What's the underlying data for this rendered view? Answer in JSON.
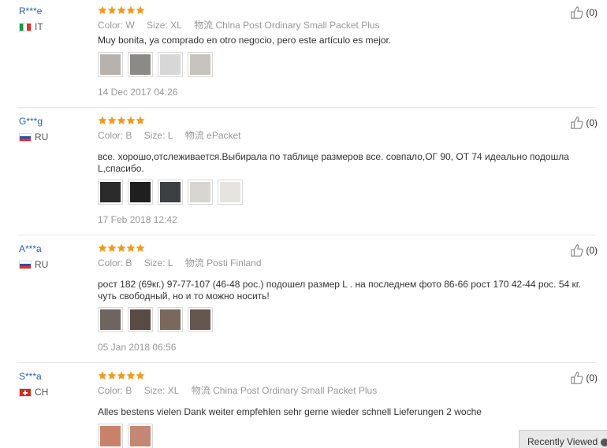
{
  "reviews": [
    {
      "user": "R***e",
      "country": "IT",
      "attr_labels": {
        "color": "Color:",
        "size": "Size:",
        "shipping": "物流"
      },
      "color": "W",
      "size": "XL",
      "shipping": "China Post Ordinary Small Packet Plus",
      "comment": "Muy bonita, ya comprado en otro negocio, pero este artículo es mejor.",
      "date": "14 Dec 2017 04:26",
      "helpful": "(0)",
      "thumbs": [
        "#b7b2ad",
        "#8c8a86",
        "#d7d7d8",
        "#c8c3ba"
      ]
    },
    {
      "user": "G***g",
      "country": "RU",
      "attr_labels": {
        "color": "Color:",
        "size": "Size:",
        "shipping": "物流"
      },
      "color": "B",
      "size": "L",
      "shipping": "ePacket",
      "comment": "все. хорошо,отслеживается.Выбирала по таблице размеров все. совпало,ОГ 90, ОТ 74 идеально подошла L,спасибо.",
      "date": "17 Feb 2018 12:42",
      "helpful": "(0)",
      "thumbs": [
        "#2b2b2b",
        "#1f1f1f",
        "#3c3f44",
        "#d9d5cf",
        "#e7e4de"
      ]
    },
    {
      "user": "A***a",
      "country": "RU",
      "attr_labels": {
        "color": "Color:",
        "size": "Size:",
        "shipping": "物流"
      },
      "color": "B",
      "size": "L",
      "shipping": "Posti Finland",
      "comment": "рост 182 (69кг.) 97-77-107 (46-48 рос.) подошел размер L . на последнем фото 86-66 рост 170 42-44 рос. 54 кг. чуть свободный, но и то можно носить!",
      "date": "05 Jan 2018 06:56",
      "helpful": "(0)",
      "thumbs": [
        "#6e6460",
        "#5a4a44",
        "#7a685e",
        "#655750"
      ]
    },
    {
      "user": "S***a",
      "country": "CH",
      "attr_labels": {
        "color": "Color:",
        "size": "Size:",
        "shipping": "物流"
      },
      "color": "B",
      "size": "XL",
      "shipping": "China Post Ordinary Small Packet Plus",
      "comment": "Alles bestens vielen Dank weiter empfehlen sehr gerne wieder schnell Lieferungen 2 woche",
      "date": "",
      "helpful": "(0)",
      "thumbs": [
        "#c9826a",
        "#c48773"
      ]
    }
  ],
  "recently_viewed": "Recently Viewed",
  "colors": {
    "link": "#2561b6",
    "star": "#f29a1f",
    "muted": "#999999"
  }
}
